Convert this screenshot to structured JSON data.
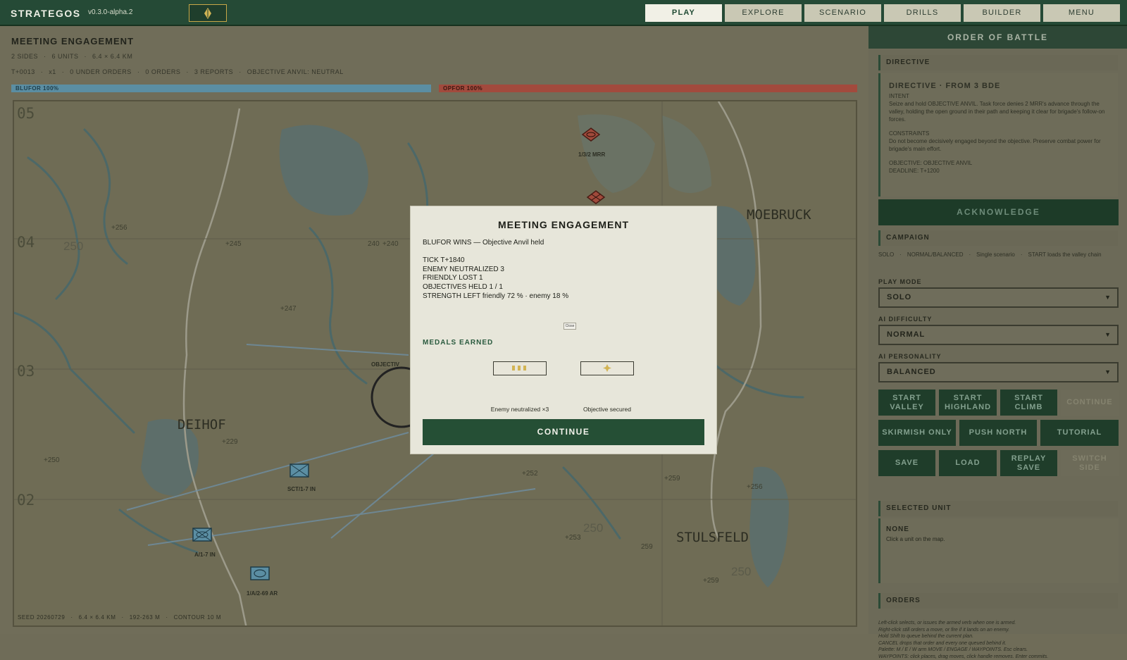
{
  "topbar": {
    "brand": "STRATEGOS",
    "version": "v0.3.0-alpha.2",
    "tabs": [
      "PLAY",
      "EXPLORE",
      "SCENARIO",
      "DRILLS",
      "BUILDER",
      "MENU"
    ],
    "active_tab": "PLAY",
    "accent": "#c8a848"
  },
  "scenario": {
    "title": "MEETING ENGAGEMENT",
    "meta": [
      "2 SIDES",
      "6 UNITS",
      "6.4 × 6.4 KM"
    ],
    "status": [
      "T+0013",
      "x1",
      "0 UNDER ORDERS",
      "0 ORDERS",
      "3 REPORTS",
      "OBJECTIVE ANVIL: NEUTRAL"
    ],
    "blufor": "BLUFOR  100%",
    "opfor": "OPFOR  100%"
  },
  "map": {
    "grid_labels": [
      "05",
      "04",
      "03",
      "02"
    ],
    "places": [
      "MOEBRUCK",
      "DEIHOF",
      "STULSFELD"
    ],
    "spot_heights": [
      "+256",
      "+245",
      "240",
      "+240",
      "+247",
      "+229",
      "+250",
      "+252",
      "+259",
      "+256",
      "+253",
      "259",
      "+259"
    ],
    "contour_labels": [
      "250",
      "250",
      "250"
    ],
    "objective_label": "OBJECTIV",
    "units": [
      "1/3/2 MRR",
      "SCT/1-7 IN",
      "A/1-7 IN",
      "1/A/2-69 AR"
    ],
    "status": [
      "SEED 20260729",
      "6.4 × 6.4 KM",
      "192-263 M",
      "CONTOUR 10 M"
    ]
  },
  "sidebar": {
    "header": "ORDER OF BATTLE",
    "directive": {
      "section": "DIRECTIVE",
      "heading": "DIRECTIVE  ·  FROM 3 BDE",
      "intent_label": "INTENT",
      "intent": "Seize and hold OBJECTIVE ANVIL. Task force denies 2 MRR's advance through the valley, holding the open ground in their path and keeping it clear for brigade's follow-on forces.",
      "constraints_label": "CONSTRAINTS",
      "constraints": "Do not become decisively engaged beyond the objective. Preserve combat power for brigade's main effort.",
      "objective": "OBJECTIVE: OBJECTIVE ANVIL",
      "deadline": "DEADLINE: T+1200",
      "acknowledge": "ACKNOWLEDGE"
    },
    "campaign": {
      "section": "CAMPAIGN",
      "items": [
        "SOLO",
        "NORMAL/BALANCED",
        "Single scenario",
        "START loads the valley chain"
      ]
    },
    "play_mode": {
      "label": "PLAY MODE",
      "value": "SOLO"
    },
    "ai_difficulty": {
      "label": "AI DIFFICULTY",
      "value": "NORMAL"
    },
    "ai_personality": {
      "label": "AI PERSONALITY",
      "value": "BALANCED"
    },
    "buttons_row1": [
      "START VALLEY",
      "START HIGHLAND",
      "START CLIMB",
      "CONTINUE"
    ],
    "buttons_row2": [
      "SKIRMISH ONLY",
      "PUSH NORTH",
      "TUTORIAL"
    ],
    "buttons_row3": [
      "SAVE",
      "LOAD",
      "REPLAY SAVE",
      "SWITCH SIDE"
    ],
    "selected_unit": {
      "section": "SELECTED UNIT",
      "name": "NONE",
      "hint": "Click a unit on the map."
    },
    "orders": {
      "section": "ORDERS",
      "lines": [
        "Left-click selects, or issues the armed verb when one is armed.",
        "Right-click still orders a move, or fire if it lands on an enemy.",
        "Hold Shift to queue behind the current plan.",
        "CANCEL drops that order and every one queued behind it.",
        "Palette: M / E / W arm MOVE / ENGAGE / WAYPOINTS. Esc clears.",
        "WAYPOINTS: click places, drag moves, click handle removes. Enter commits."
      ]
    }
  },
  "modal": {
    "title": "MEETING ENGAGEMENT",
    "result": "BLUFOR WINS — Objective Anvil held",
    "stats": [
      "TICK  T+1840",
      "ENEMY NEUTRALIZED  3",
      "FRIENDLY LOST  1",
      "OBJECTIVES HELD  1 / 1",
      "STRENGTH LEFT  friendly 72 % · enemy 18 %"
    ],
    "close": "Close",
    "medals_heading": "MEDALS EARNED",
    "medals": [
      "Enemy neutralized ×3",
      "Objective secured"
    ],
    "continue": "CONTINUE"
  }
}
